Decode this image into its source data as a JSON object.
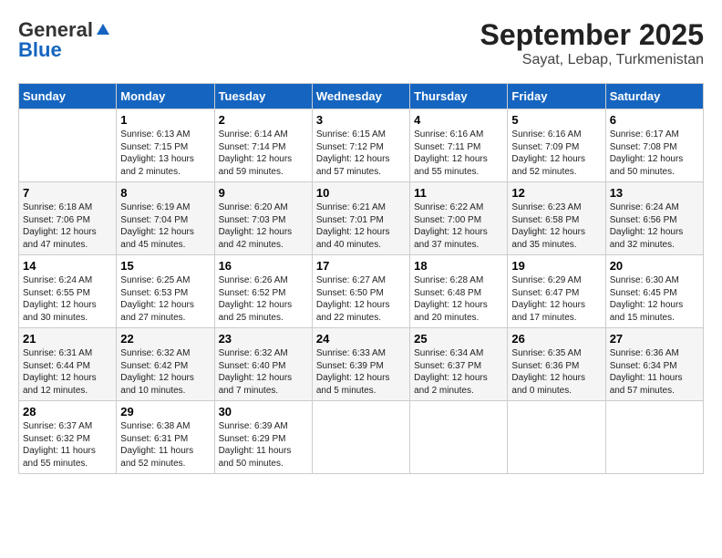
{
  "header": {
    "logo_general": "General",
    "logo_blue": "Blue",
    "month": "September 2025",
    "location": "Sayat, Lebap, Turkmenistan"
  },
  "weekdays": [
    "Sunday",
    "Monday",
    "Tuesday",
    "Wednesday",
    "Thursday",
    "Friday",
    "Saturday"
  ],
  "weeks": [
    [
      {
        "day": "",
        "sunrise": "",
        "sunset": "",
        "daylight": ""
      },
      {
        "day": "1",
        "sunrise": "Sunrise: 6:13 AM",
        "sunset": "Sunset: 7:15 PM",
        "daylight": "Daylight: 13 hours and 2 minutes."
      },
      {
        "day": "2",
        "sunrise": "Sunrise: 6:14 AM",
        "sunset": "Sunset: 7:14 PM",
        "daylight": "Daylight: 12 hours and 59 minutes."
      },
      {
        "day": "3",
        "sunrise": "Sunrise: 6:15 AM",
        "sunset": "Sunset: 7:12 PM",
        "daylight": "Daylight: 12 hours and 57 minutes."
      },
      {
        "day": "4",
        "sunrise": "Sunrise: 6:16 AM",
        "sunset": "Sunset: 7:11 PM",
        "daylight": "Daylight: 12 hours and 55 minutes."
      },
      {
        "day": "5",
        "sunrise": "Sunrise: 6:16 AM",
        "sunset": "Sunset: 7:09 PM",
        "daylight": "Daylight: 12 hours and 52 minutes."
      },
      {
        "day": "6",
        "sunrise": "Sunrise: 6:17 AM",
        "sunset": "Sunset: 7:08 PM",
        "daylight": "Daylight: 12 hours and 50 minutes."
      }
    ],
    [
      {
        "day": "7",
        "sunrise": "Sunrise: 6:18 AM",
        "sunset": "Sunset: 7:06 PM",
        "daylight": "Daylight: 12 hours and 47 minutes."
      },
      {
        "day": "8",
        "sunrise": "Sunrise: 6:19 AM",
        "sunset": "Sunset: 7:04 PM",
        "daylight": "Daylight: 12 hours and 45 minutes."
      },
      {
        "day": "9",
        "sunrise": "Sunrise: 6:20 AM",
        "sunset": "Sunset: 7:03 PM",
        "daylight": "Daylight: 12 hours and 42 minutes."
      },
      {
        "day": "10",
        "sunrise": "Sunrise: 6:21 AM",
        "sunset": "Sunset: 7:01 PM",
        "daylight": "Daylight: 12 hours and 40 minutes."
      },
      {
        "day": "11",
        "sunrise": "Sunrise: 6:22 AM",
        "sunset": "Sunset: 7:00 PM",
        "daylight": "Daylight: 12 hours and 37 minutes."
      },
      {
        "day": "12",
        "sunrise": "Sunrise: 6:23 AM",
        "sunset": "Sunset: 6:58 PM",
        "daylight": "Daylight: 12 hours and 35 minutes."
      },
      {
        "day": "13",
        "sunrise": "Sunrise: 6:24 AM",
        "sunset": "Sunset: 6:56 PM",
        "daylight": "Daylight: 12 hours and 32 minutes."
      }
    ],
    [
      {
        "day": "14",
        "sunrise": "Sunrise: 6:24 AM",
        "sunset": "Sunset: 6:55 PM",
        "daylight": "Daylight: 12 hours and 30 minutes."
      },
      {
        "day": "15",
        "sunrise": "Sunrise: 6:25 AM",
        "sunset": "Sunset: 6:53 PM",
        "daylight": "Daylight: 12 hours and 27 minutes."
      },
      {
        "day": "16",
        "sunrise": "Sunrise: 6:26 AM",
        "sunset": "Sunset: 6:52 PM",
        "daylight": "Daylight: 12 hours and 25 minutes."
      },
      {
        "day": "17",
        "sunrise": "Sunrise: 6:27 AM",
        "sunset": "Sunset: 6:50 PM",
        "daylight": "Daylight: 12 hours and 22 minutes."
      },
      {
        "day": "18",
        "sunrise": "Sunrise: 6:28 AM",
        "sunset": "Sunset: 6:48 PM",
        "daylight": "Daylight: 12 hours and 20 minutes."
      },
      {
        "day": "19",
        "sunrise": "Sunrise: 6:29 AM",
        "sunset": "Sunset: 6:47 PM",
        "daylight": "Daylight: 12 hours and 17 minutes."
      },
      {
        "day": "20",
        "sunrise": "Sunrise: 6:30 AM",
        "sunset": "Sunset: 6:45 PM",
        "daylight": "Daylight: 12 hours and 15 minutes."
      }
    ],
    [
      {
        "day": "21",
        "sunrise": "Sunrise: 6:31 AM",
        "sunset": "Sunset: 6:44 PM",
        "daylight": "Daylight: 12 hours and 12 minutes."
      },
      {
        "day": "22",
        "sunrise": "Sunrise: 6:32 AM",
        "sunset": "Sunset: 6:42 PM",
        "daylight": "Daylight: 12 hours and 10 minutes."
      },
      {
        "day": "23",
        "sunrise": "Sunrise: 6:32 AM",
        "sunset": "Sunset: 6:40 PM",
        "daylight": "Daylight: 12 hours and 7 minutes."
      },
      {
        "day": "24",
        "sunrise": "Sunrise: 6:33 AM",
        "sunset": "Sunset: 6:39 PM",
        "daylight": "Daylight: 12 hours and 5 minutes."
      },
      {
        "day": "25",
        "sunrise": "Sunrise: 6:34 AM",
        "sunset": "Sunset: 6:37 PM",
        "daylight": "Daylight: 12 hours and 2 minutes."
      },
      {
        "day": "26",
        "sunrise": "Sunrise: 6:35 AM",
        "sunset": "Sunset: 6:36 PM",
        "daylight": "Daylight: 12 hours and 0 minutes."
      },
      {
        "day": "27",
        "sunrise": "Sunrise: 6:36 AM",
        "sunset": "Sunset: 6:34 PM",
        "daylight": "Daylight: 11 hours and 57 minutes."
      }
    ],
    [
      {
        "day": "28",
        "sunrise": "Sunrise: 6:37 AM",
        "sunset": "Sunset: 6:32 PM",
        "daylight": "Daylight: 11 hours and 55 minutes."
      },
      {
        "day": "29",
        "sunrise": "Sunrise: 6:38 AM",
        "sunset": "Sunset: 6:31 PM",
        "daylight": "Daylight: 11 hours and 52 minutes."
      },
      {
        "day": "30",
        "sunrise": "Sunrise: 6:39 AM",
        "sunset": "Sunset: 6:29 PM",
        "daylight": "Daylight: 11 hours and 50 minutes."
      },
      {
        "day": "",
        "sunrise": "",
        "sunset": "",
        "daylight": ""
      },
      {
        "day": "",
        "sunrise": "",
        "sunset": "",
        "daylight": ""
      },
      {
        "day": "",
        "sunrise": "",
        "sunset": "",
        "daylight": ""
      },
      {
        "day": "",
        "sunrise": "",
        "sunset": "",
        "daylight": ""
      }
    ]
  ]
}
